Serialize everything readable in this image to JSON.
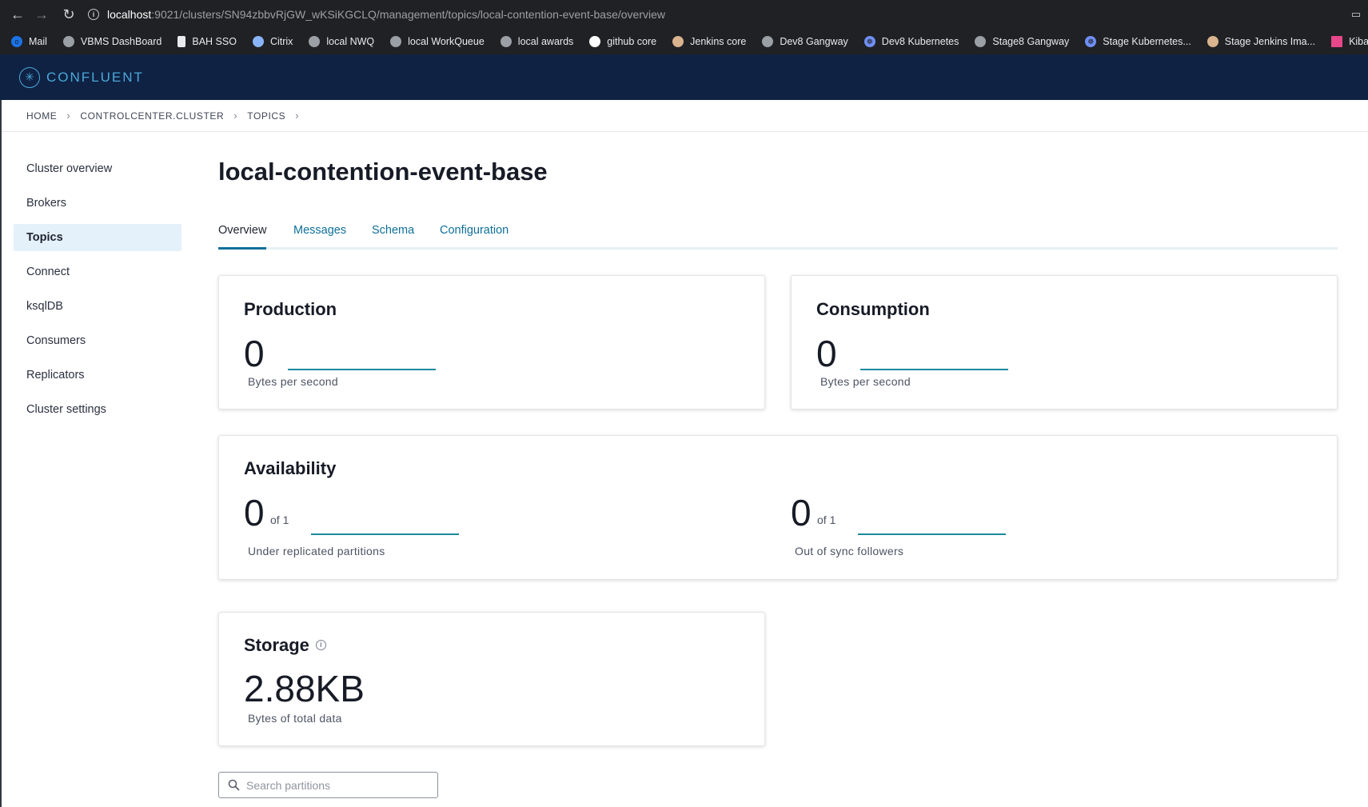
{
  "browser": {
    "url_host": "localhost",
    "url_path": ":9021/clusters/SN94zbbvRjGW_wKSiKGCLQ/management/topics/local-contention-event-base/overview",
    "bookmarks": [
      {
        "label": "Mail",
        "icon": "outlook-icon",
        "color": "#1a73e8"
      },
      {
        "label": "VBMS DashBoard",
        "icon": "globe-icon",
        "color": "#9aa0a6"
      },
      {
        "label": "BAH SSO",
        "icon": "doc-icon",
        "color": "#e8eaed"
      },
      {
        "label": "Citrix",
        "icon": "lock-icon",
        "color": "#8ab4f8"
      },
      {
        "label": "local NWQ",
        "icon": "globe-icon",
        "color": "#9aa0a6"
      },
      {
        "label": "local WorkQueue",
        "icon": "globe-icon",
        "color": "#9aa0a6"
      },
      {
        "label": "local awards",
        "icon": "globe-icon",
        "color": "#9aa0a6"
      },
      {
        "label": "github core",
        "icon": "github-icon",
        "color": "#ffffff"
      },
      {
        "label": "Jenkins core",
        "icon": "jenkins-icon",
        "color": "#d9b48f"
      },
      {
        "label": "Dev8 Gangway",
        "icon": "globe-icon",
        "color": "#9aa0a6"
      },
      {
        "label": "Dev8 Kubernetes",
        "icon": "kubernetes-icon",
        "color": "#6f8ff7"
      },
      {
        "label": "Stage8 Gangway",
        "icon": "globe-icon",
        "color": "#9aa0a6"
      },
      {
        "label": "Stage Kubernetes...",
        "icon": "kubernetes-icon",
        "color": "#6f8ff7"
      },
      {
        "label": "Stage Jenkins Ima...",
        "icon": "jenkins-icon",
        "color": "#d9b48f"
      },
      {
        "label": "Kibana",
        "icon": "kibana-icon",
        "color": "#e8478b"
      }
    ]
  },
  "app": {
    "logo_text": "CONFLUENT",
    "accent": "#0e6f99",
    "header_bg": "#0f2244"
  },
  "breadcrumb": {
    "items": [
      "HOME",
      "CONTROLCENTER.CLUSTER",
      "TOPICS"
    ]
  },
  "sidebar": {
    "items": [
      {
        "label": "Cluster overview"
      },
      {
        "label": "Brokers"
      },
      {
        "label": "Topics"
      },
      {
        "label": "Connect"
      },
      {
        "label": "ksqlDB"
      },
      {
        "label": "Consumers"
      },
      {
        "label": "Replicators"
      },
      {
        "label": "Cluster settings"
      }
    ],
    "active": "Topics"
  },
  "page": {
    "title": "local-contention-event-base",
    "tabs": [
      "Overview",
      "Messages",
      "Schema",
      "Configuration"
    ],
    "active_tab": "Overview"
  },
  "production": {
    "title": "Production",
    "value": "0",
    "label": "Bytes per second"
  },
  "consumption": {
    "title": "Consumption",
    "value": "0",
    "label": "Bytes per second"
  },
  "availability": {
    "title": "Availability",
    "under_replicated": {
      "value": "0",
      "of": "of 1",
      "label": "Under replicated partitions"
    },
    "out_of_sync": {
      "value": "0",
      "of": "of 1",
      "label": "Out of sync followers"
    }
  },
  "storage": {
    "title": "Storage",
    "value": "2.88KB",
    "label": "Bytes of total data"
  },
  "search": {
    "placeholder": "Search partitions",
    "value": ""
  }
}
